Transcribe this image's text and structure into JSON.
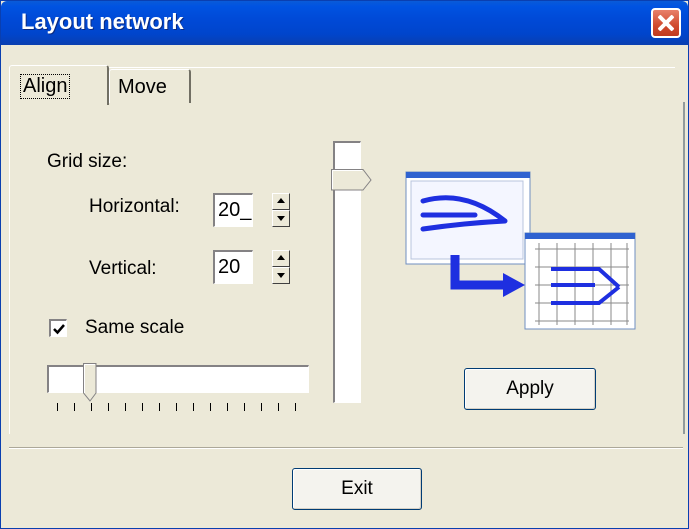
{
  "window": {
    "title": "Layout network"
  },
  "tabs": [
    {
      "label": "Align",
      "selected": true
    },
    {
      "label": "Move",
      "selected": false
    }
  ],
  "align": {
    "grid_size_label": "Grid size:",
    "horizontal_label": "Horizontal:",
    "horizontal_value": "20_",
    "vertical_label": "Vertical:",
    "vertical_value": "20",
    "same_scale_label": "Same scale",
    "same_scale_checked": true,
    "apply_label": "Apply"
  },
  "footer": {
    "exit_label": "Exit"
  },
  "colors": {
    "title_bar": "#0055e5",
    "close_button": "#d04a2e",
    "dialog_bg": "#ece9d8",
    "illustration_line": "#1e2fe0"
  }
}
